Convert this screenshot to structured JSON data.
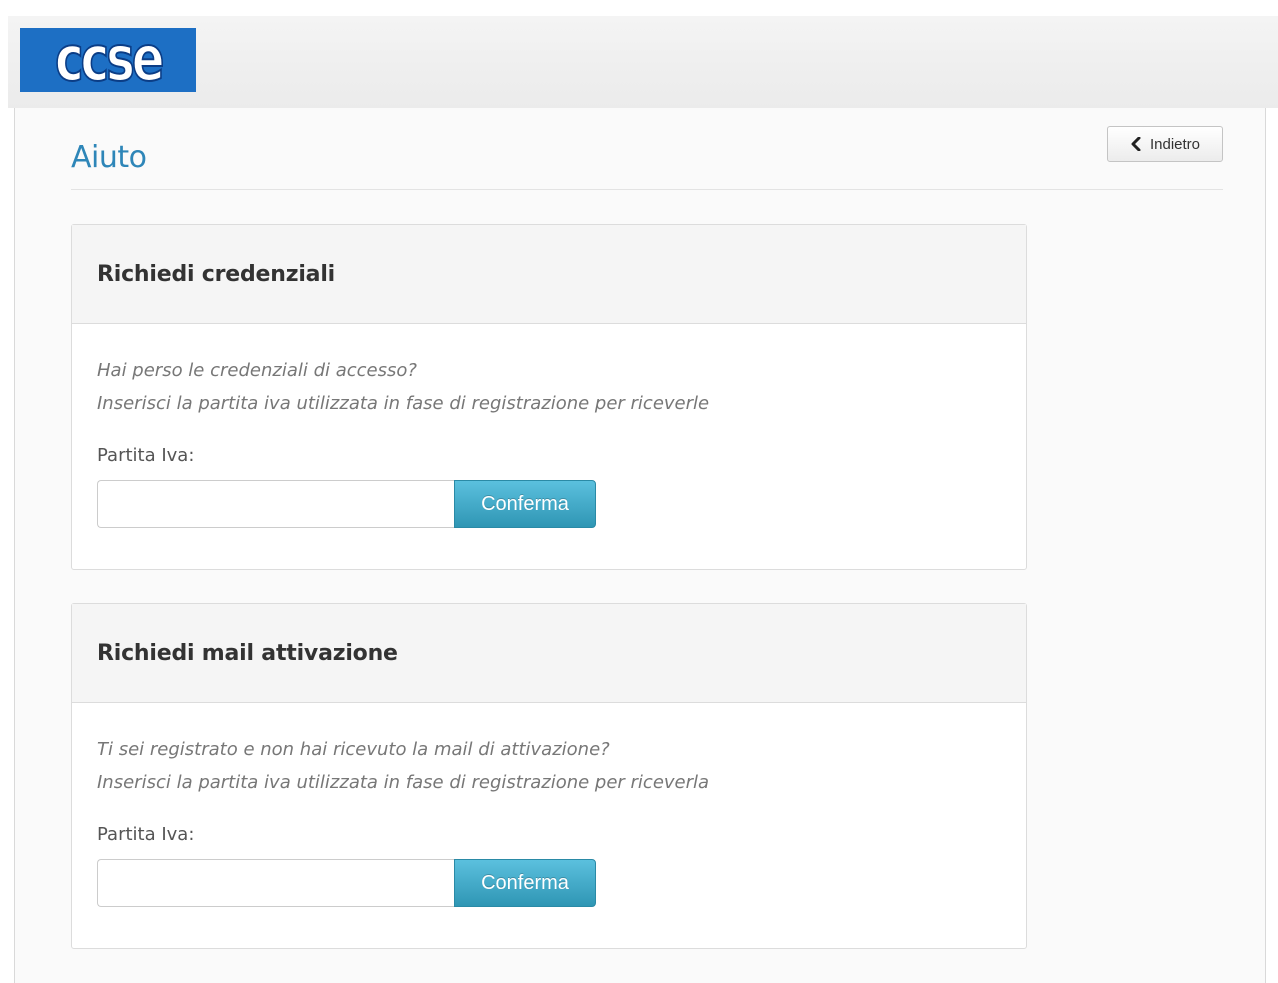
{
  "header": {
    "logo_text": "ccse"
  },
  "page": {
    "title": "Aiuto",
    "back_label": "Indietro"
  },
  "panels": [
    {
      "title": "Richiedi credenziali",
      "hint_line1": "Hai perso le credenziali di accesso?",
      "hint_line2": "Inserisci la partita iva utilizzata in fase di registrazione per riceverle",
      "field_label": "Partita Iva:",
      "input_value": "",
      "confirm_label": "Conferma"
    },
    {
      "title": "Richiedi mail attivazione",
      "hint_line1": "Ti sei registrato e non hai ricevuto la mail di attivazione?",
      "hint_line2": "Inserisci la partita iva utilizzata in fase di registrazione per riceverla",
      "field_label": "Partita Iva:",
      "input_value": "",
      "confirm_label": "Conferma"
    }
  ],
  "colors": {
    "brand_blue": "#1d6fc4",
    "title_blue": "#2e86b8",
    "button_info": "#5bc0de"
  },
  "icons": {
    "back": "chevron-left-icon"
  }
}
